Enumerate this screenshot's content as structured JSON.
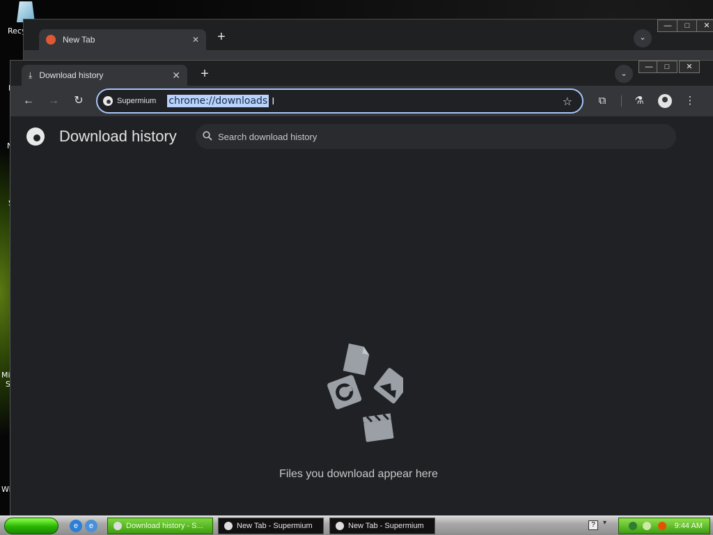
{
  "desktop": {
    "labels": [
      "Recy",
      "I",
      "N",
      "S",
      "Mic",
      "S",
      "Wi"
    ]
  },
  "back_window": {
    "tab_title": "New Tab",
    "tab_close": "✕",
    "new_tab": "+",
    "tab_search": "⌄"
  },
  "window": {
    "tab_title": "Download history",
    "tab_close": "✕",
    "new_tab": "+",
    "tab_search": "⌄",
    "minimize": "—",
    "maximize": "□",
    "close": "✕"
  },
  "toolbar": {
    "site_chip": "Supermium",
    "url": "chrome://downloads"
  },
  "page": {
    "title": "Download history",
    "search_placeholder": "Search download history",
    "empty_text": "Files you download appear here"
  },
  "taskbar": {
    "tasks": [
      {
        "label": "Download history - S..."
      },
      {
        "label": "New Tab - Supermium"
      },
      {
        "label": "New Tab - Supermium"
      }
    ],
    "help": "?",
    "clock": "9:44 AM"
  },
  "colors": {
    "omnibox_focus": "#a8c7fa",
    "page_bg": "#202124",
    "toolbar_bg": "#35363a",
    "active_task": "#3e9d0e"
  }
}
